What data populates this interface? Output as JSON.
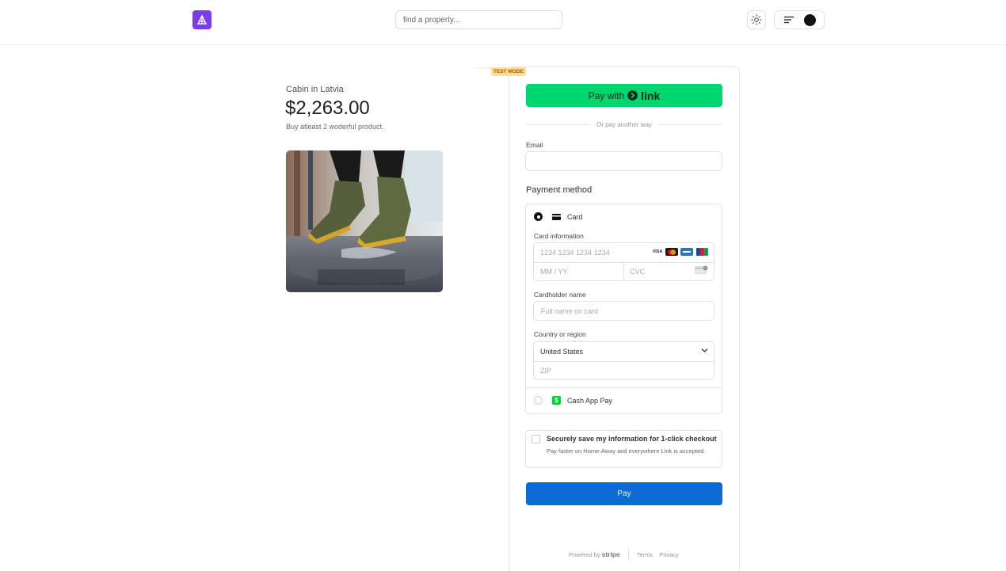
{
  "header": {
    "search_placeholder": "find a property...",
    "icons": [
      "logo-icon",
      "sun-icon",
      "menu-icon",
      "avatar"
    ]
  },
  "product": {
    "name": "Cabin in Latvia",
    "price": "$2,263.00",
    "description": "Buy atleast 2 woderful product."
  },
  "checkout": {
    "test_mode": "TEST MODE",
    "link_button": {
      "prefix": "Pay with",
      "brand": "link"
    },
    "divider_text": "Or pay another way",
    "email_label": "Email",
    "email_value": "",
    "payment_method_title": "Payment method",
    "card": {
      "label": "Card",
      "info_label": "Card information",
      "number_placeholder": "1234 1234 1234 1234",
      "expiry_placeholder": "MM / YY",
      "cvc_placeholder": "CVC",
      "brands": [
        "VISA",
        "mastercard",
        "amex",
        "JCB"
      ]
    },
    "cardholder": {
      "label": "Cardholder name",
      "placeholder": "Full name on card"
    },
    "country": {
      "label": "Country or region",
      "value": "United States",
      "zip_placeholder": "ZIP"
    },
    "cashapp_label": "Cash App Pay",
    "save": {
      "title": "Securely save my information for 1-click checkout",
      "description": "Pay faster on Home-Away and everywhere Link is accepted.",
      "checked": false
    },
    "pay_label": "Pay",
    "footer": {
      "powered_by": "Powered by",
      "stripe": "stripe",
      "terms": "Terms",
      "privacy": "Privacy"
    }
  },
  "colors": {
    "brand_purple": "#7c3aed",
    "link_green": "#00d66f",
    "pay_blue": "#0d6bd6",
    "cashapp_green": "#00d632",
    "test_badge": "#ffde92"
  }
}
